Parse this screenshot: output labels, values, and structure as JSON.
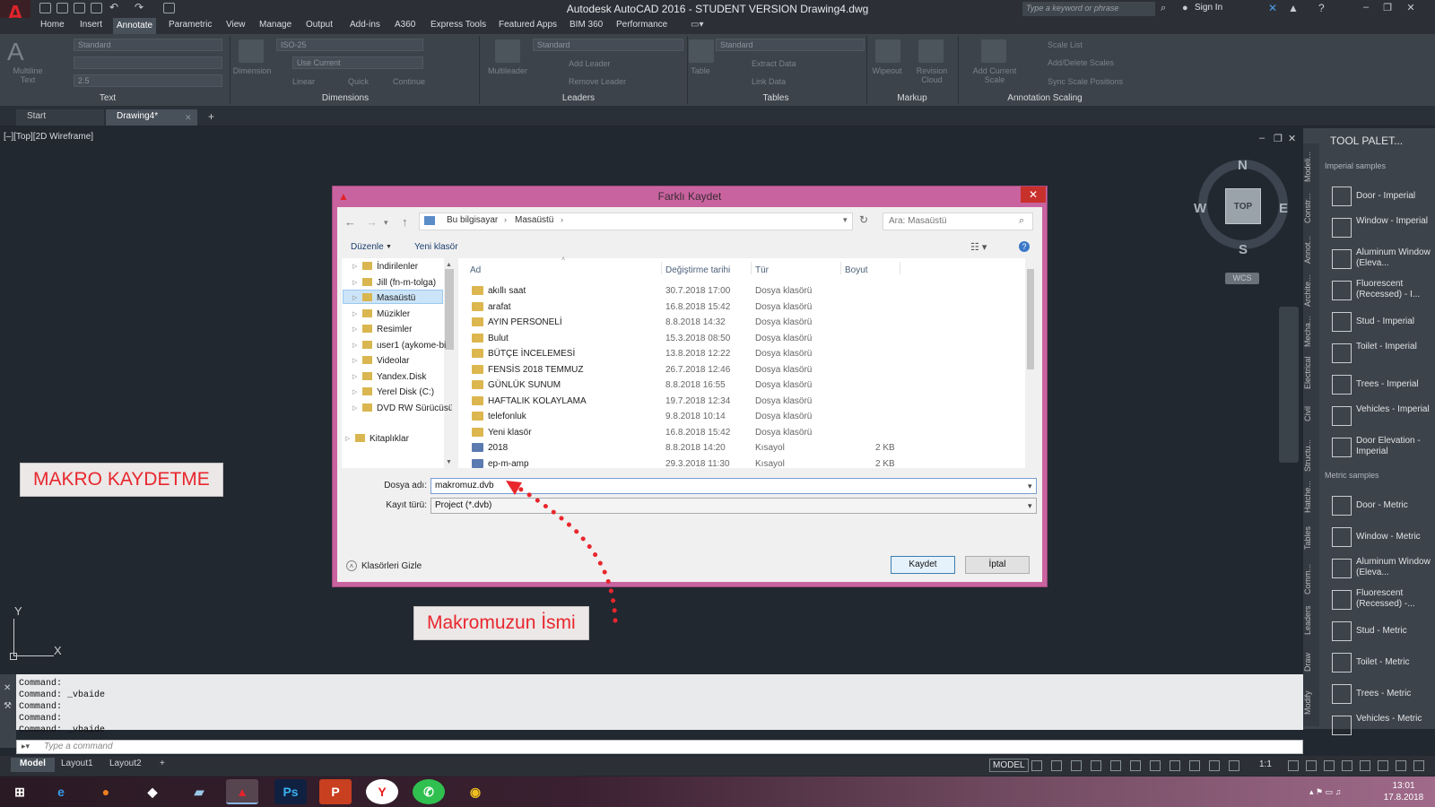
{
  "app": {
    "title": "Autodesk AutoCAD 2016 - STUDENT VERSION    Drawing4.dwg",
    "search_placeholder": "Type a keyword or phrase",
    "sign_in": "Sign In"
  },
  "menu_tabs": [
    "Home",
    "Insert",
    "Annotate",
    "Parametric",
    "View",
    "Manage",
    "Output",
    "Add-ins",
    "A360",
    "Express Tools",
    "Featured Apps",
    "BIM 360",
    "Performance"
  ],
  "ribbon": {
    "text_panel": {
      "title": "Text",
      "multiline": "Multiline Text",
      "style": "Standard",
      "height": "2.5"
    },
    "dimensions_panel": {
      "title": "Dimensions",
      "dimension": "Dimension",
      "style": "ISO-25",
      "layer": "Use Current",
      "linear": "Linear",
      "quick": "Quick",
      "continue": "Continue"
    },
    "leaders_panel": {
      "title": "Leaders",
      "multileader": "Multileader",
      "style": "Standard",
      "add_leader": "Add Leader",
      "remove_leader": "Remove Leader"
    },
    "tables_panel": {
      "title": "Tables",
      "table": "Table",
      "style": "Standard",
      "extract_data": "Extract Data",
      "link_data": "Link Data"
    },
    "markup_panel": {
      "title": "Markup",
      "wipeout": "Wipeout",
      "revision_cloud": "Revision Cloud"
    },
    "scaling_panel": {
      "title": "Annotation Scaling",
      "add_current_scale": "Add Current Scale",
      "scale_list": "Scale List",
      "add_delete_scales": "Add/Delete Scales",
      "sync_scale_positions": "Sync Scale Positions"
    }
  },
  "doc_tabs": [
    "Start",
    "Drawing4*"
  ],
  "viewport_label": "[–][Top][2D Wireframe]",
  "viewcube": {
    "top": "TOP",
    "n": "N",
    "s": "S",
    "e": "E",
    "w": "W",
    "wcs": "WCS"
  },
  "ucs": {
    "y": "Y",
    "x": "X"
  },
  "callouts": {
    "left": "MAKRO KAYDETME",
    "bottom": "Makromuzun İsmi"
  },
  "dialog": {
    "title": "Farklı Kaydet",
    "path": [
      "Bu bilgisayar",
      "Masaüstü"
    ],
    "search_placeholder": "Ara: Masaüstü",
    "organize": "Düzenle",
    "new_folder": "Yeni klasör",
    "tree": [
      "İndirilenler",
      "Jill (fn-m-tolga)",
      "Masaüstü",
      "Müzikler",
      "Resimler",
      "user1 (aykome-bi",
      "Videolar",
      "Yandex.Disk",
      "Yerel Disk (C:)",
      "DVD RW Sürücüsü",
      "Kitaplıklar"
    ],
    "columns": [
      "Ad",
      "Değiştirme tarihi",
      "Tür",
      "Boyut"
    ],
    "files": [
      {
        "name": "akıllı saat",
        "date": "30.7.2018 17:00",
        "type": "Dosya klasörü",
        "size": ""
      },
      {
        "name": "arafat",
        "date": "16.8.2018 15:42",
        "type": "Dosya klasörü",
        "size": ""
      },
      {
        "name": "AYIN PERSONELİ",
        "date": "8.8.2018 14:32",
        "type": "Dosya klasörü",
        "size": ""
      },
      {
        "name": "Bulut",
        "date": "15.3.2018 08:50",
        "type": "Dosya klasörü",
        "size": ""
      },
      {
        "name": "BÜTÇE İNCELEMESİ",
        "date": "13.8.2018 12:22",
        "type": "Dosya klasörü",
        "size": ""
      },
      {
        "name": "FENSİS 2018 TEMMUZ",
        "date": "26.7.2018 12:46",
        "type": "Dosya klasörü",
        "size": ""
      },
      {
        "name": "GÜNLÜK SUNUM",
        "date": "8.8.2018 16:55",
        "type": "Dosya klasörü",
        "size": ""
      },
      {
        "name": "HAFTALIK KOLAYLAMA",
        "date": "19.7.2018 12:34",
        "type": "Dosya klasörü",
        "size": ""
      },
      {
        "name": "telefonluk",
        "date": "9.8.2018 10:14",
        "type": "Dosya klasörü",
        "size": ""
      },
      {
        "name": "Yeni klasör",
        "date": "16.8.2018 15:42",
        "type": "Dosya klasörü",
        "size": ""
      },
      {
        "name": "2018",
        "date": "8.8.2018 14:20",
        "type": "Kısayol",
        "size": "2 KB"
      },
      {
        "name": "ep-m-amp",
        "date": "29.3.2018 11:30",
        "type": "Kısayol",
        "size": "2 KB"
      }
    ],
    "filename_label": "Dosya adı:",
    "filename_value": "makromuz.dvb",
    "filetype_label": "Kayıt türü:",
    "filetype_value": "Project (*.dvb)",
    "hide_folders": "Klasörleri Gizle",
    "save": "Kaydet",
    "cancel": "İptal"
  },
  "palette": {
    "title": "TOOL PALET...",
    "imperial_header": "Imperial samples",
    "metric_header": "Metric samples",
    "imperial": [
      "Door - Imperial",
      "Window - Imperial",
      "Aluminum Window (Eleva...",
      "Fluorescent (Recessed) - I...",
      "Stud - Imperial",
      "Toilet - Imperial",
      "Trees - Imperial",
      "Vehicles - Imperial",
      "Door Elevation - Imperial"
    ],
    "metric": [
      "Door - Metric",
      "Window - Metric",
      "Aluminum Window (Eleva...",
      "Fluorescent (Recessed) -...",
      "Stud - Metric",
      "Toilet - Metric",
      "Trees - Metric",
      "Vehicles - Metric"
    ],
    "vtabs": [
      "Modeli...",
      "Constr...",
      "Annot...",
      "Archite...",
      "Mecha...",
      "Electrical",
      "Civil",
      "Structu...",
      "Hatche...",
      "Tables",
      "Comm...",
      "Leaders",
      "Draw",
      "Modify"
    ]
  },
  "command": {
    "history": [
      "Command:",
      "Command: _vbaide",
      "Command:",
      "Command:",
      "Command: _vbaide"
    ],
    "placeholder": "Type a command"
  },
  "layout_tabs": [
    "Model",
    "Layout1",
    "Layout2"
  ],
  "status": {
    "model": "MODEL",
    "scale": "1:1"
  },
  "clock": {
    "time": "13:01",
    "date": "17.8.2018"
  },
  "colors": {
    "accent_red": "#e8272d",
    "dialog_frame": "#c9639f",
    "drawing_bg": "#212830"
  }
}
